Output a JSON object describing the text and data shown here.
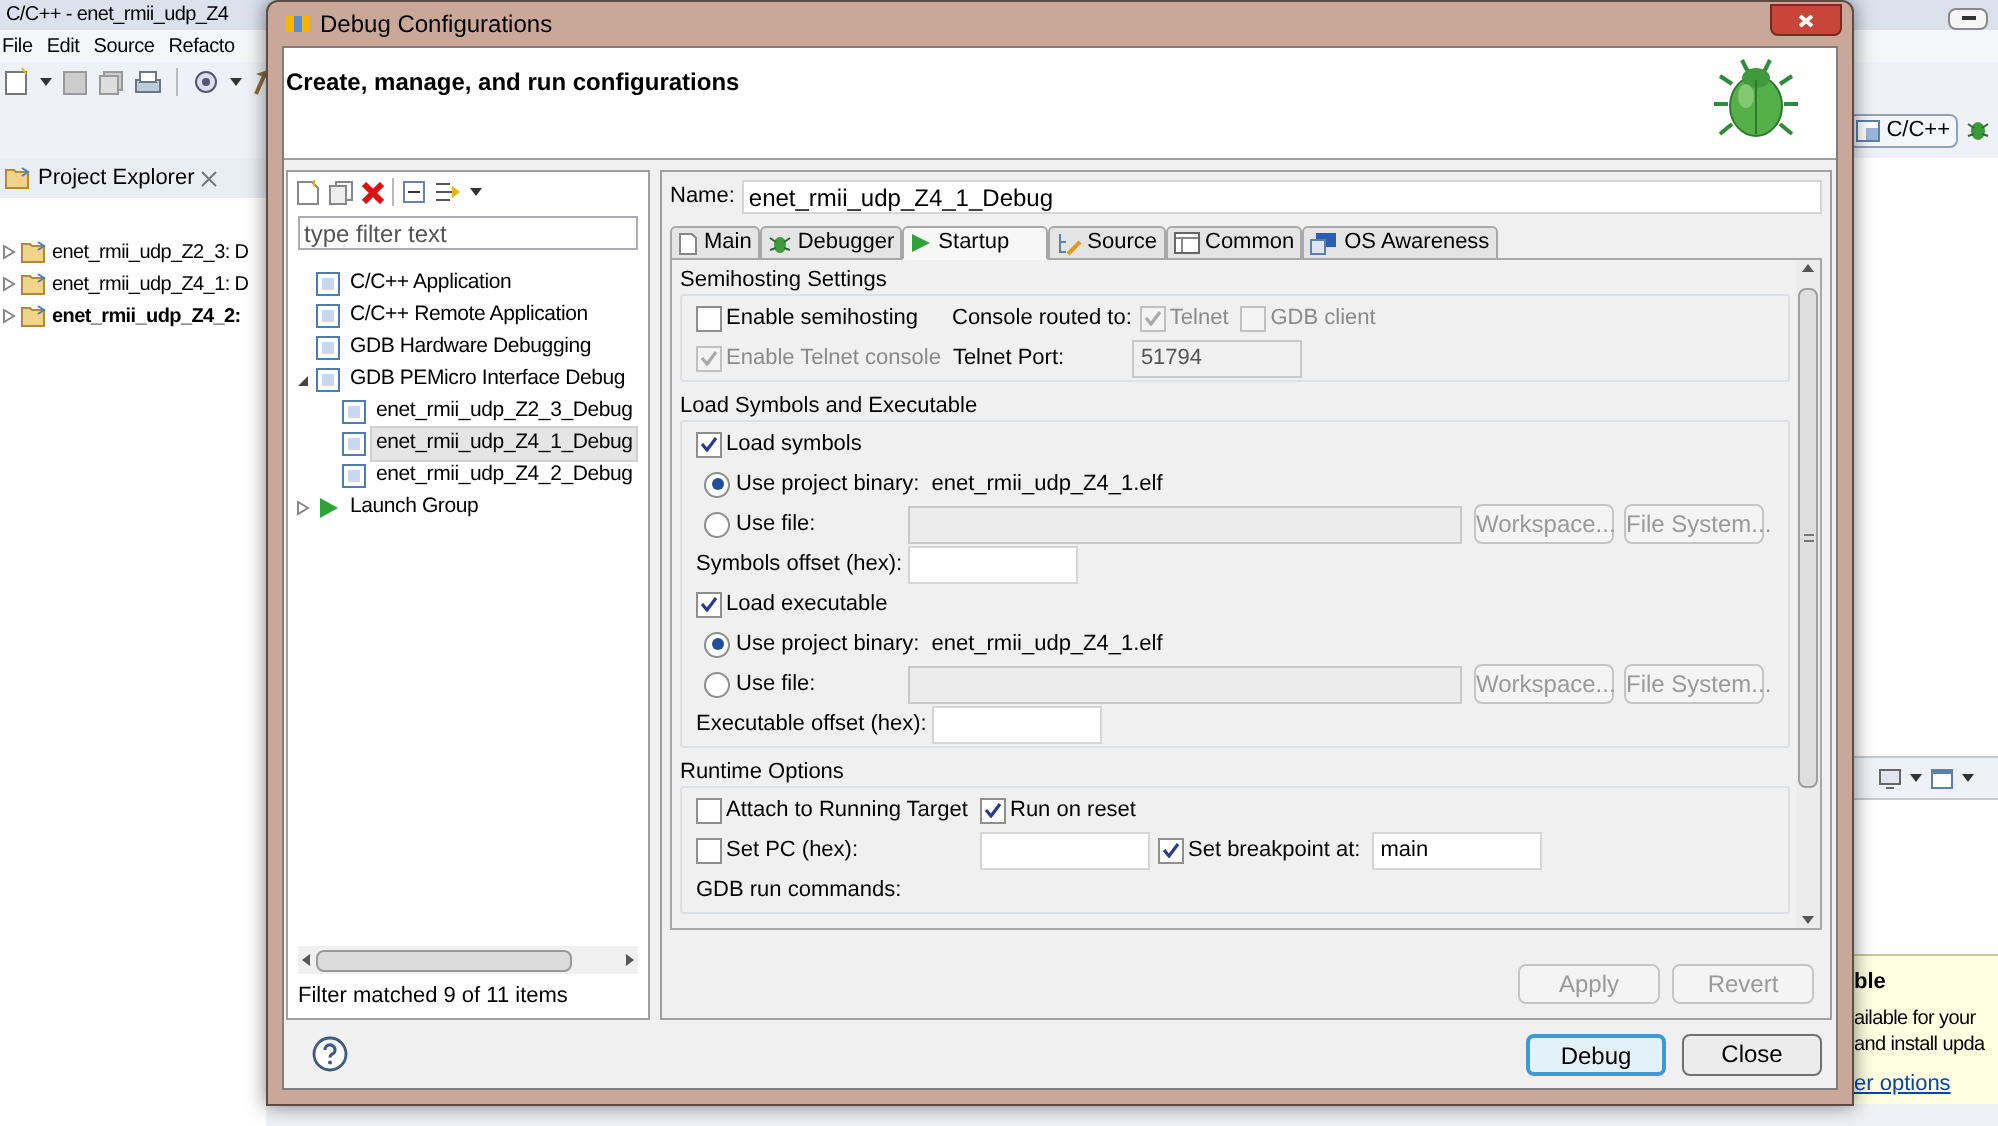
{
  "ide": {
    "title": "C/C++ - enet_rmii_udp_Z4",
    "menu": [
      "File",
      "Edit",
      "Source",
      "Refacto"
    ],
    "explorer": {
      "title": "Project Explorer",
      "projects": [
        {
          "label": "enet_rmii_udp_Z2_3: D",
          "bold": false
        },
        {
          "label": "enet_rmii_udp_Z4_1: D",
          "bold": false
        },
        {
          "label": "enet_rmii_udp_Z4_2:",
          "bold": true
        }
      ]
    },
    "perspective": "C/C++",
    "notification": {
      "title": "ble",
      "lines": [
        "ailable for your",
        "and install upda"
      ],
      "link": "er options"
    }
  },
  "dialog": {
    "title": "Debug Configurations",
    "header": "Create, manage, and run configurations",
    "filter": {
      "placeholder": "type filter text"
    },
    "tree": [
      {
        "kind": "config_type",
        "label": "C/C++ Application",
        "selected": false
      },
      {
        "kind": "config_type",
        "label": "C/C++ Remote Application",
        "selected": false
      },
      {
        "kind": "config_type",
        "label": "GDB Hardware Debugging",
        "selected": false
      },
      {
        "kind": "config_type",
        "label": "GDB PEMicro Interface Debug",
        "selected": false,
        "expanded": true,
        "children": [
          {
            "kind": "config",
            "label": "enet_rmii_udp_Z2_3_Debug",
            "selected": false
          },
          {
            "kind": "config",
            "label": "enet_rmii_udp_Z4_1_Debug",
            "selected": true
          },
          {
            "kind": "config",
            "label": "enet_rmii_udp_Z4_2_Debug",
            "selected": false
          }
        ]
      },
      {
        "kind": "launch_group",
        "label": "Launch Group",
        "selected": false,
        "expanded": false
      }
    ],
    "filter_status": "Filter matched 9 of 11 items",
    "name": {
      "label": "Name:",
      "value": "enet_rmii_udp_Z4_1_Debug"
    },
    "tabs": [
      {
        "label": "Main",
        "selected": false
      },
      {
        "label": "Debugger",
        "selected": false
      },
      {
        "label": "Startup",
        "selected": true
      },
      {
        "label": "Source",
        "selected": false
      },
      {
        "label": "Common",
        "selected": false
      },
      {
        "label": "OS Awareness",
        "selected": false
      }
    ],
    "groups": [
      {
        "title": "Semihosting Settings",
        "rows": [
          {
            "items": [
              {
                "kind": "checkbox",
                "label": "Enable semihosting",
                "checked": false,
                "disabled": false
              },
              {
                "kind": "label",
                "text": "Console routed to:"
              },
              {
                "kind": "checkbox",
                "label": "Telnet",
                "checked": true,
                "disabled": true
              },
              {
                "kind": "checkbox",
                "label": "GDB client",
                "checked": false,
                "disabled": true
              }
            ]
          },
          {
            "items": [
              {
                "kind": "checkbox",
                "label": "Enable Telnet console",
                "checked": true,
                "disabled": true
              },
              {
                "kind": "label",
                "text": "Telnet Port:"
              },
              {
                "kind": "field",
                "value": "51794",
                "disabled": true
              }
            ]
          }
        ]
      },
      {
        "title": "Load Symbols and Executable",
        "rows": [
          {
            "items": [
              {
                "kind": "checkbox",
                "label": "Load symbols",
                "checked": true,
                "disabled": false
              }
            ]
          },
          {
            "items": [
              {
                "kind": "radio",
                "label": "Use project binary:",
                "selected": true
              },
              {
                "kind": "value",
                "text": "enet_rmii_udp_Z4_1.elf"
              }
            ]
          },
          {
            "items": [
              {
                "kind": "radio",
                "label": "Use file:",
                "selected": false
              },
              {
                "kind": "path_field",
                "disabled": true
              },
              {
                "kind": "button",
                "label": "Workspace...",
                "disabled": true
              },
              {
                "kind": "button",
                "label": "File System...",
                "disabled": true
              }
            ]
          },
          {
            "items": [
              {
                "kind": "label",
                "text": "Symbols offset (hex):"
              },
              {
                "kind": "field",
                "disabled": false
              }
            ]
          },
          {
            "items": [
              {
                "kind": "checkbox",
                "label": "Load executable",
                "checked": true,
                "disabled": false
              }
            ]
          },
          {
            "items": [
              {
                "kind": "radio",
                "label": "Use project binary:",
                "selected": true
              },
              {
                "kind": "value",
                "text": "enet_rmii_udp_Z4_1.elf"
              }
            ]
          },
          {
            "items": [
              {
                "kind": "radio",
                "label": "Use file:",
                "selected": false
              },
              {
                "kind": "path_field",
                "disabled": true
              },
              {
                "kind": "button",
                "label": "Workspace...",
                "disabled": true
              },
              {
                "kind": "button",
                "label": "File System...",
                "disabled": true
              }
            ]
          },
          {
            "items": [
              {
                "kind": "label",
                "text": "Executable offset (hex):"
              },
              {
                "kind": "field",
                "disabled": false
              }
            ]
          }
        ]
      },
      {
        "title": "Runtime Options",
        "rows": [
          {
            "items": [
              {
                "kind": "checkbox",
                "label": "Attach to Running Target",
                "checked": false,
                "disabled": false
              },
              {
                "kind": "checkbox",
                "label": "Run on reset",
                "checked": true,
                "disabled": false
              }
            ]
          },
          {
            "items": [
              {
                "kind": "checkbox",
                "label": "Set PC (hex):",
                "checked": false,
                "disabled": false
              },
              {
                "kind": "field",
                "disabled": false
              },
              {
                "kind": "checkbox",
                "label": "Set breakpoint at:",
                "checked": true,
                "disabled": false
              },
              {
                "kind": "field",
                "value": "main",
                "disabled": false
              }
            ]
          },
          {
            "items": [
              {
                "kind": "label",
                "text": "GDB run commands:"
              }
            ]
          }
        ]
      }
    ],
    "buttons": [
      {
        "label": "Apply",
        "disabled": true
      },
      {
        "label": "Revert",
        "disabled": true
      }
    ],
    "footer_buttons": [
      {
        "label": "Debug",
        "default": true
      },
      {
        "label": "Close",
        "default": false
      }
    ]
  }
}
